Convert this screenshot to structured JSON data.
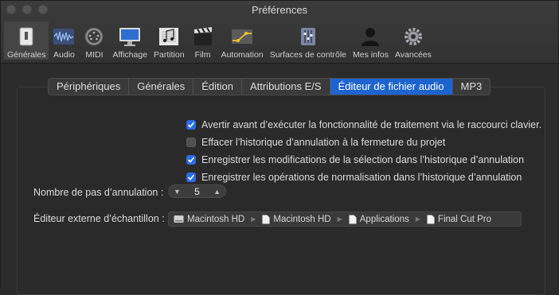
{
  "window": {
    "title": "Préférences"
  },
  "toolbar": {
    "items": [
      {
        "label": "Générales",
        "icon": "switch-icon",
        "selected": true
      },
      {
        "label": "Audio",
        "icon": "waveform-icon"
      },
      {
        "label": "MIDI",
        "icon": "midi-port-icon"
      },
      {
        "label": "Affichage",
        "icon": "display-icon"
      },
      {
        "label": "Partition",
        "icon": "music-notes-icon"
      },
      {
        "label": "Film",
        "icon": "clapperboard-icon"
      },
      {
        "label": "Automation",
        "icon": "automation-icon"
      },
      {
        "label": "Surfaces de contrôle",
        "icon": "faders-icon"
      },
      {
        "label": "Mes infos",
        "icon": "user-icon"
      },
      {
        "label": "Avancées",
        "icon": "gear-icon"
      }
    ]
  },
  "tabs": [
    {
      "label": "Périphériques"
    },
    {
      "label": "Générales"
    },
    {
      "label": "Édition"
    },
    {
      "label": "Attributions E/S"
    },
    {
      "label": "Éditeur de fichier audio",
      "active": true
    },
    {
      "label": "MP3"
    }
  ],
  "options": [
    {
      "label": "Avertir avant d’exécuter la fonctionnalité de traitement via le raccourci clavier.",
      "checked": true
    },
    {
      "label": "Effacer l’historique d’annulation à la fermeture du projet",
      "checked": false
    },
    {
      "label": "Enregistrer les modifications de la sélection dans l’historique d’annulation",
      "checked": true
    },
    {
      "label": "Enregistrer les opérations de normalisation dans l’historique d’annulation",
      "checked": true
    }
  ],
  "undo_steps": {
    "label": "Nombre de pas d’annulation :",
    "value": "5"
  },
  "external_editor": {
    "label": "Éditeur externe d’échantillon :",
    "path": [
      "Macintosh HD",
      "Macintosh HD",
      "Applications",
      "Final Cut Pro"
    ]
  },
  "colors": {
    "accent": "#1e64d0",
    "checkbox": "#2a6de6"
  }
}
